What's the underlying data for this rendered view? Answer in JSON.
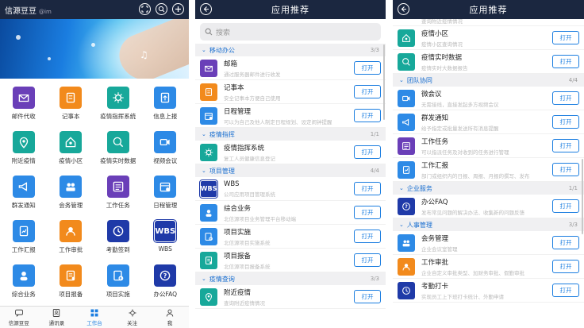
{
  "colors": {
    "header_bg": "#1b2740",
    "accent": "#1a7de0",
    "tile_purple": "#6a3fb8",
    "tile_orange": "#f28a1c",
    "tile_teal": "#17a89a",
    "tile_blue": "#2d8ae6",
    "tile_navy": "#1f3aa8"
  },
  "home": {
    "app_name": "信源豆豆",
    "user_tag": "@im",
    "apps": [
      {
        "label": "邮件代收",
        "icon": "mail-icon",
        "color": "#6a3fb8"
      },
      {
        "label": "记事本",
        "icon": "notepad-icon",
        "color": "#f28a1c"
      },
      {
        "label": "疫情指挥系统",
        "icon": "virus-icon",
        "color": "#17a89a"
      },
      {
        "label": "信息上报",
        "icon": "report-upload-icon",
        "color": "#2d8ae6"
      },
      {
        "label": "附近疫情",
        "icon": "location-virus-icon",
        "color": "#17a89a"
      },
      {
        "label": "疫情小区",
        "icon": "community-icon",
        "color": "#17a89a"
      },
      {
        "label": "疫情实时数据",
        "icon": "realtime-data-icon",
        "color": "#17a89a"
      },
      {
        "label": "视频会议",
        "icon": "video-camera-icon",
        "color": "#2d8ae6"
      },
      {
        "label": "群发通知",
        "icon": "megaphone-icon",
        "color": "#2d8ae6"
      },
      {
        "label": "会务管理",
        "icon": "meeting-icon",
        "color": "#2d8ae6"
      },
      {
        "label": "工作任务",
        "icon": "task-list-icon",
        "color": "#6a3fb8"
      },
      {
        "label": "日程管理",
        "icon": "calendar-icon",
        "color": "#2d8ae6"
      },
      {
        "label": "工作汇报",
        "icon": "work-report-icon",
        "color": "#2d8ae6"
      },
      {
        "label": "工作审批",
        "icon": "approval-icon",
        "color": "#f28a1c"
      },
      {
        "label": "考勤签到",
        "icon": "clock-icon",
        "color": "#1f3aa8"
      },
      {
        "label": "WBS",
        "icon": "wbs-icon",
        "color": "#1f3aa8",
        "text": "WBS"
      },
      {
        "label": "综合业务",
        "icon": "people-icon",
        "color": "#2d8ae6"
      },
      {
        "label": "项目报备",
        "icon": "project-report-icon",
        "color": "#f28a1c"
      },
      {
        "label": "项目实施",
        "icon": "project-gear-icon",
        "color": "#2d8ae6"
      },
      {
        "label": "办公FAQ",
        "icon": "faq-icon",
        "color": "#1f3aa8"
      }
    ],
    "tabs": [
      {
        "label": "信源豆豆",
        "icon": "chat-icon",
        "active": false
      },
      {
        "label": "通讯录",
        "icon": "contacts-icon",
        "active": false
      },
      {
        "label": "工作台",
        "icon": "workbench-icon",
        "active": true
      },
      {
        "label": "关注",
        "icon": "focus-icon",
        "active": false
      },
      {
        "label": "我",
        "icon": "person-icon",
        "active": false
      }
    ]
  },
  "rec1": {
    "title": "应用推荐",
    "search_placeholder": "搜索",
    "open_label": "打开",
    "sections": [
      {
        "title": "移动办公",
        "count": "3/3",
        "items": [
          {
            "name": "邮箱",
            "desc": "通过服务器邮件进行收发",
            "icon": "mail-icon",
            "color": "#6a3fb8"
          },
          {
            "name": "记事本",
            "desc": "安全记事本方便自己使用",
            "icon": "notepad-icon",
            "color": "#f28a1c"
          },
          {
            "name": "日程管理",
            "desc": "可以为自己及他人制定日程规划、设定闹钟提醒",
            "icon": "calendar-icon",
            "color": "#2d8ae6"
          }
        ]
      },
      {
        "title": "疫情指挥",
        "count": "1/1",
        "items": [
          {
            "name": "疫情指挥系统",
            "desc": "复工人员健康信息登记",
            "icon": "virus-icon",
            "color": "#17a89a"
          }
        ]
      },
      {
        "title": "项目管理",
        "count": "4/4",
        "items": [
          {
            "name": "WBS",
            "desc": "公司应用项目管理系统",
            "icon": "wbs-icon",
            "color": "#1f3aa8",
            "text": "WBS"
          },
          {
            "name": "综合业务",
            "desc": "北信源项目业务管理平台移动端",
            "icon": "people-icon",
            "color": "#2d8ae6"
          },
          {
            "name": "项目实施",
            "desc": "北信源项目实施系统",
            "icon": "project-gear-icon",
            "color": "#2d8ae6"
          },
          {
            "name": "项目报备",
            "desc": "北信源项目报备系统",
            "icon": "project-report-icon",
            "color": "#17a89a"
          }
        ]
      },
      {
        "title": "疫情查询",
        "count": "3/3",
        "items": [
          {
            "name": "附近疫情",
            "desc": "查询附近疫情情况",
            "icon": "location-virus-icon",
            "color": "#17a89a"
          }
        ]
      }
    ]
  },
  "rec2": {
    "title": "应用推荐",
    "open_label": "打开",
    "top_partial_desc": "查询附近疫情情况",
    "top_items": [
      {
        "name": "疫情小区",
        "desc": "疫情小区查询情况",
        "icon": "community-icon",
        "color": "#17a89a"
      },
      {
        "name": "疫情实时数据",
        "desc": "疫情实时大数据报告",
        "icon": "realtime-data-icon",
        "color": "#17a89a"
      }
    ],
    "sections": [
      {
        "title": "团队协同",
        "count": "4/4",
        "items": [
          {
            "name": "微会议",
            "desc": "无需接线，直接发起多方视频会议",
            "icon": "video-camera-icon",
            "color": "#2d8ae6"
          },
          {
            "name": "群发通知",
            "desc": "给予指定或批量发送所有消息提醒",
            "icon": "megaphone-icon",
            "color": "#2d8ae6"
          },
          {
            "name": "工作任务",
            "desc": "可以指派任务及对收到的任务进行管理",
            "icon": "task-list-icon",
            "color": "#6a3fb8"
          },
          {
            "name": "工作汇报",
            "desc": "部门或组织内的日报、周报、月报的撰写、发布",
            "icon": "work-report-icon",
            "color": "#2d8ae6"
          }
        ]
      },
      {
        "title": "企业服务",
        "count": "1/1",
        "items": [
          {
            "name": "办公FAQ",
            "desc": "发布常见问题的解决办法、收集新的问题反馈",
            "icon": "faq-icon",
            "color": "#1f3aa8"
          }
        ]
      },
      {
        "title": "人事管理",
        "count": "3/3",
        "items": [
          {
            "name": "会务管理",
            "desc": "企业会议室管理",
            "icon": "meeting-icon",
            "color": "#2d8ae6"
          },
          {
            "name": "工作审批",
            "desc": "企业自定义审批类型、加财务审批、假勤审批",
            "icon": "approval-icon",
            "color": "#f28a1c"
          },
          {
            "name": "考勤打卡",
            "desc": "实现员工上下班打卡统计、外勤申请",
            "icon": "clock-icon",
            "color": "#1f3aa8"
          }
        ]
      }
    ]
  }
}
